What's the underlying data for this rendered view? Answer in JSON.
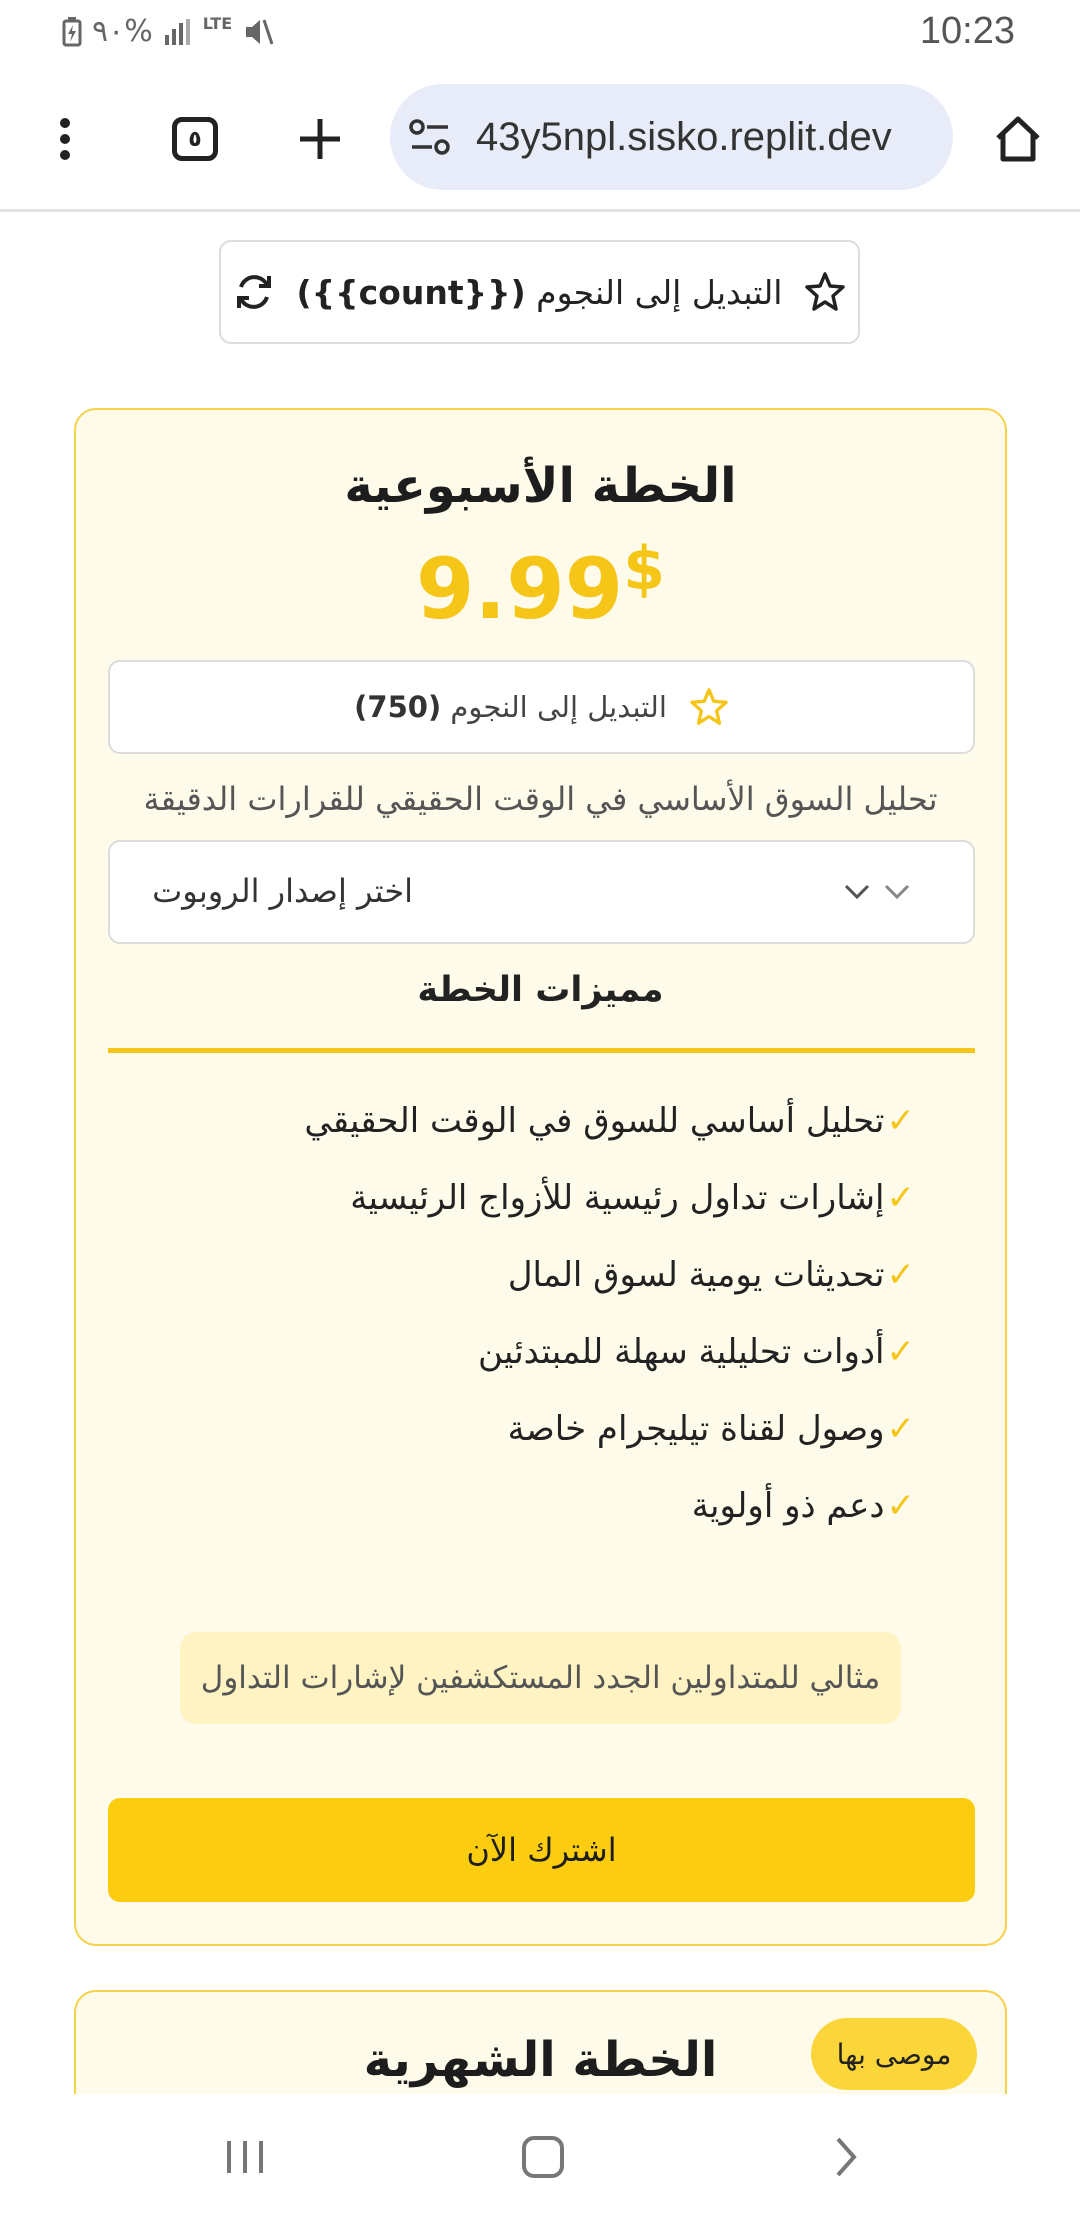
{
  "status_bar": {
    "battery": "٩٠%",
    "network": "LTE",
    "time": "10:23"
  },
  "browser": {
    "url": "43y5npl.sisko.replit.dev",
    "tab_count": "٥",
    "icons": [
      "more-vert-icon",
      "tabs-icon",
      "new-tab-icon",
      "site-settings-icon",
      "home-icon"
    ]
  },
  "top_toggle": {
    "label": "التبديل إلى النجوم",
    "count": "({{count}})"
  },
  "plan": {
    "title": "الخطة الأسبوعية",
    "price": "9.99",
    "currency": "$",
    "stars_label": "التبديل إلى النجوم",
    "stars_count": "(750)",
    "description": "تحليل السوق الأساسي في الوقت الحقيقي للقرارات الدقيقة",
    "select_placeholder": "اختر إصدار الروبوت",
    "features_title": "مميزات الخطة",
    "features": [
      "تحليل أساسي للسوق في الوقت الحقيقي",
      "إشارات تداول رئيسية للأزواج الرئيسية",
      "تحديثات يومية لسوق المال",
      "أدوات تحليلية سهلة للمبتدئين",
      "وصول لقناة تيليجرام خاصة",
      "دعم ذو أولوية"
    ],
    "check_mark": "✓",
    "ideal_for": "مثالي للمتداولين الجدد المستكشفين لإشارات التداول",
    "subscribe_label": "اشترك الآن"
  },
  "plan2": {
    "title": "الخطة الشهرية",
    "badge": "موصى بها"
  },
  "colors": {
    "accent": "#f5c518",
    "button": "#fbcc0f",
    "card_bg": "#fffbea",
    "card_border": "#f6d24b",
    "url_pill": "#e8ecf8"
  }
}
